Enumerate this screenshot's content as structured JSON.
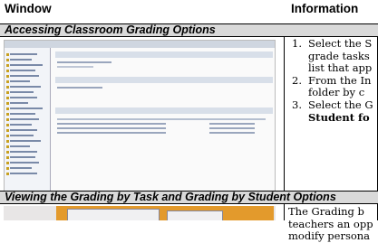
{
  "table": {
    "headers": {
      "window": "Window",
      "information": "Information"
    },
    "sections": [
      {
        "title": "Accessing Classroom Grading Options",
        "steps": [
          {
            "num": "1.",
            "lines": [
              "Select the S",
              "grade tasks",
              "list that app"
            ]
          },
          {
            "num": "2.",
            "lines": [
              "From the In",
              "folder by c"
            ]
          },
          {
            "num": "3.",
            "lines": [
              "Select the G",
              "Student fo"
            ]
          }
        ]
      },
      {
        "title": "Viewing the Grading by Task and Grading by Student Options",
        "text_lines": [
          "The Grading b",
          "teachers an opp",
          "modify persona"
        ]
      }
    ]
  }
}
